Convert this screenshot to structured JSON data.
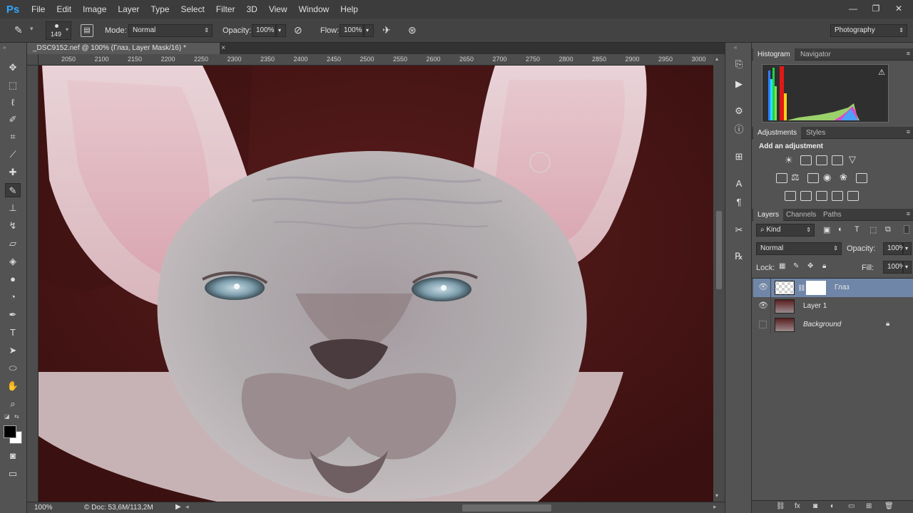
{
  "app": {
    "logo": "Ps"
  },
  "menu": [
    "File",
    "Edit",
    "Image",
    "Layer",
    "Type",
    "Select",
    "Filter",
    "3D",
    "View",
    "Window",
    "Help"
  ],
  "window_controls": [
    "minimize-icon",
    "restore-icon",
    "close-icon"
  ],
  "options": {
    "brush_size": "149",
    "mode_label": "Mode:",
    "mode_value": "Normal",
    "opacity_label": "Opacity:",
    "opacity_value": "100%",
    "flow_label": "Flow:",
    "flow_value": "100%",
    "workspace": "Photography"
  },
  "document": {
    "tab_title": "_DSC9152.nef @ 100% (Глаз, Layer Mask/16) *",
    "ruler_ticks": [
      "2050",
      "2100",
      "2150",
      "2200",
      "2250",
      "2300",
      "2350",
      "2400",
      "2450",
      "2500",
      "2550",
      "2600",
      "2650",
      "2700",
      "2750",
      "2800",
      "2850",
      "2900",
      "2950",
      "3000"
    ]
  },
  "status": {
    "zoom": "100%",
    "doc_info": "Doc: 53,6M/113,2M"
  },
  "panels": {
    "top_tabs": [
      "Histogram",
      "Navigator"
    ],
    "adjust_tabs": [
      "Adjustments",
      "Styles"
    ],
    "adjust_title": "Add an adjustment",
    "layers_tabs": [
      "Layers",
      "Channels",
      "Paths"
    ],
    "filter_kind": "Kind",
    "blend_mode": "Normal",
    "opacity_label": "Opacity:",
    "opacity_value": "100%",
    "lock_label": "Lock:",
    "fill_label": "Fill:",
    "fill_value": "100%",
    "layers": [
      {
        "name": "Глаз",
        "visible": true,
        "selected": true,
        "has_mask": true
      },
      {
        "name": "Layer 1",
        "visible": true,
        "selected": false
      },
      {
        "name": "Background",
        "visible": false,
        "locked": true,
        "italic": true
      }
    ]
  },
  "colors": {
    "accent": "#31a8ff",
    "selected_layer": "#6f86a8",
    "canvas_bg": "#4b1818"
  }
}
